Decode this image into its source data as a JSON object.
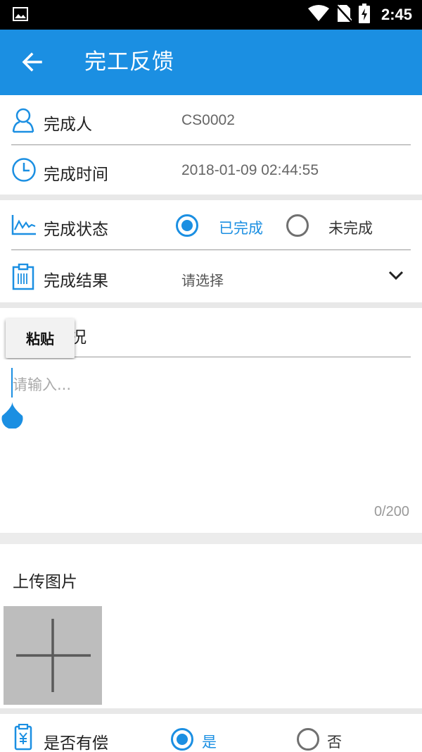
{
  "status_bar": {
    "time": "2:45",
    "icons": [
      "gallery-icon",
      "wifi-icon",
      "no-sim-icon",
      "battery-charging-icon"
    ]
  },
  "app_bar": {
    "title": "完工反馈",
    "back_icon": "arrow-left-icon"
  },
  "form": {
    "completer": {
      "label": "完成人",
      "value": "CS0002",
      "icon": "person-icon"
    },
    "completion_time": {
      "label": "完成时间",
      "value": "2018-01-09 02:44:55",
      "icon": "clock-icon"
    },
    "completion_status": {
      "label": "完成状态",
      "icon": "chart-icon",
      "options": [
        {
          "label": "已完成",
          "selected": true
        },
        {
          "label": "未完成",
          "selected": false
        }
      ]
    },
    "completion_result": {
      "label": "完成结果",
      "placeholder": "请选择",
      "icon": "clipboard-icon"
    },
    "situation": {
      "label_visible_fragment": "况",
      "placeholder": "请输入...",
      "counter": "0/200"
    },
    "paste_menu": {
      "label": "粘贴"
    },
    "upload": {
      "title": "上传图片"
    },
    "compensated": {
      "label": "是否有偿",
      "icon": "payment-icon",
      "options": [
        {
          "label": "是",
          "selected": true
        },
        {
          "label": "否",
          "selected": false
        }
      ]
    }
  },
  "colors": {
    "primary": "#1b8fe2",
    "status_bar": "#000000",
    "divider": "#9a9a9a",
    "section_gap": "#e8e8e8",
    "upload_box": "#bdbdbd"
  }
}
